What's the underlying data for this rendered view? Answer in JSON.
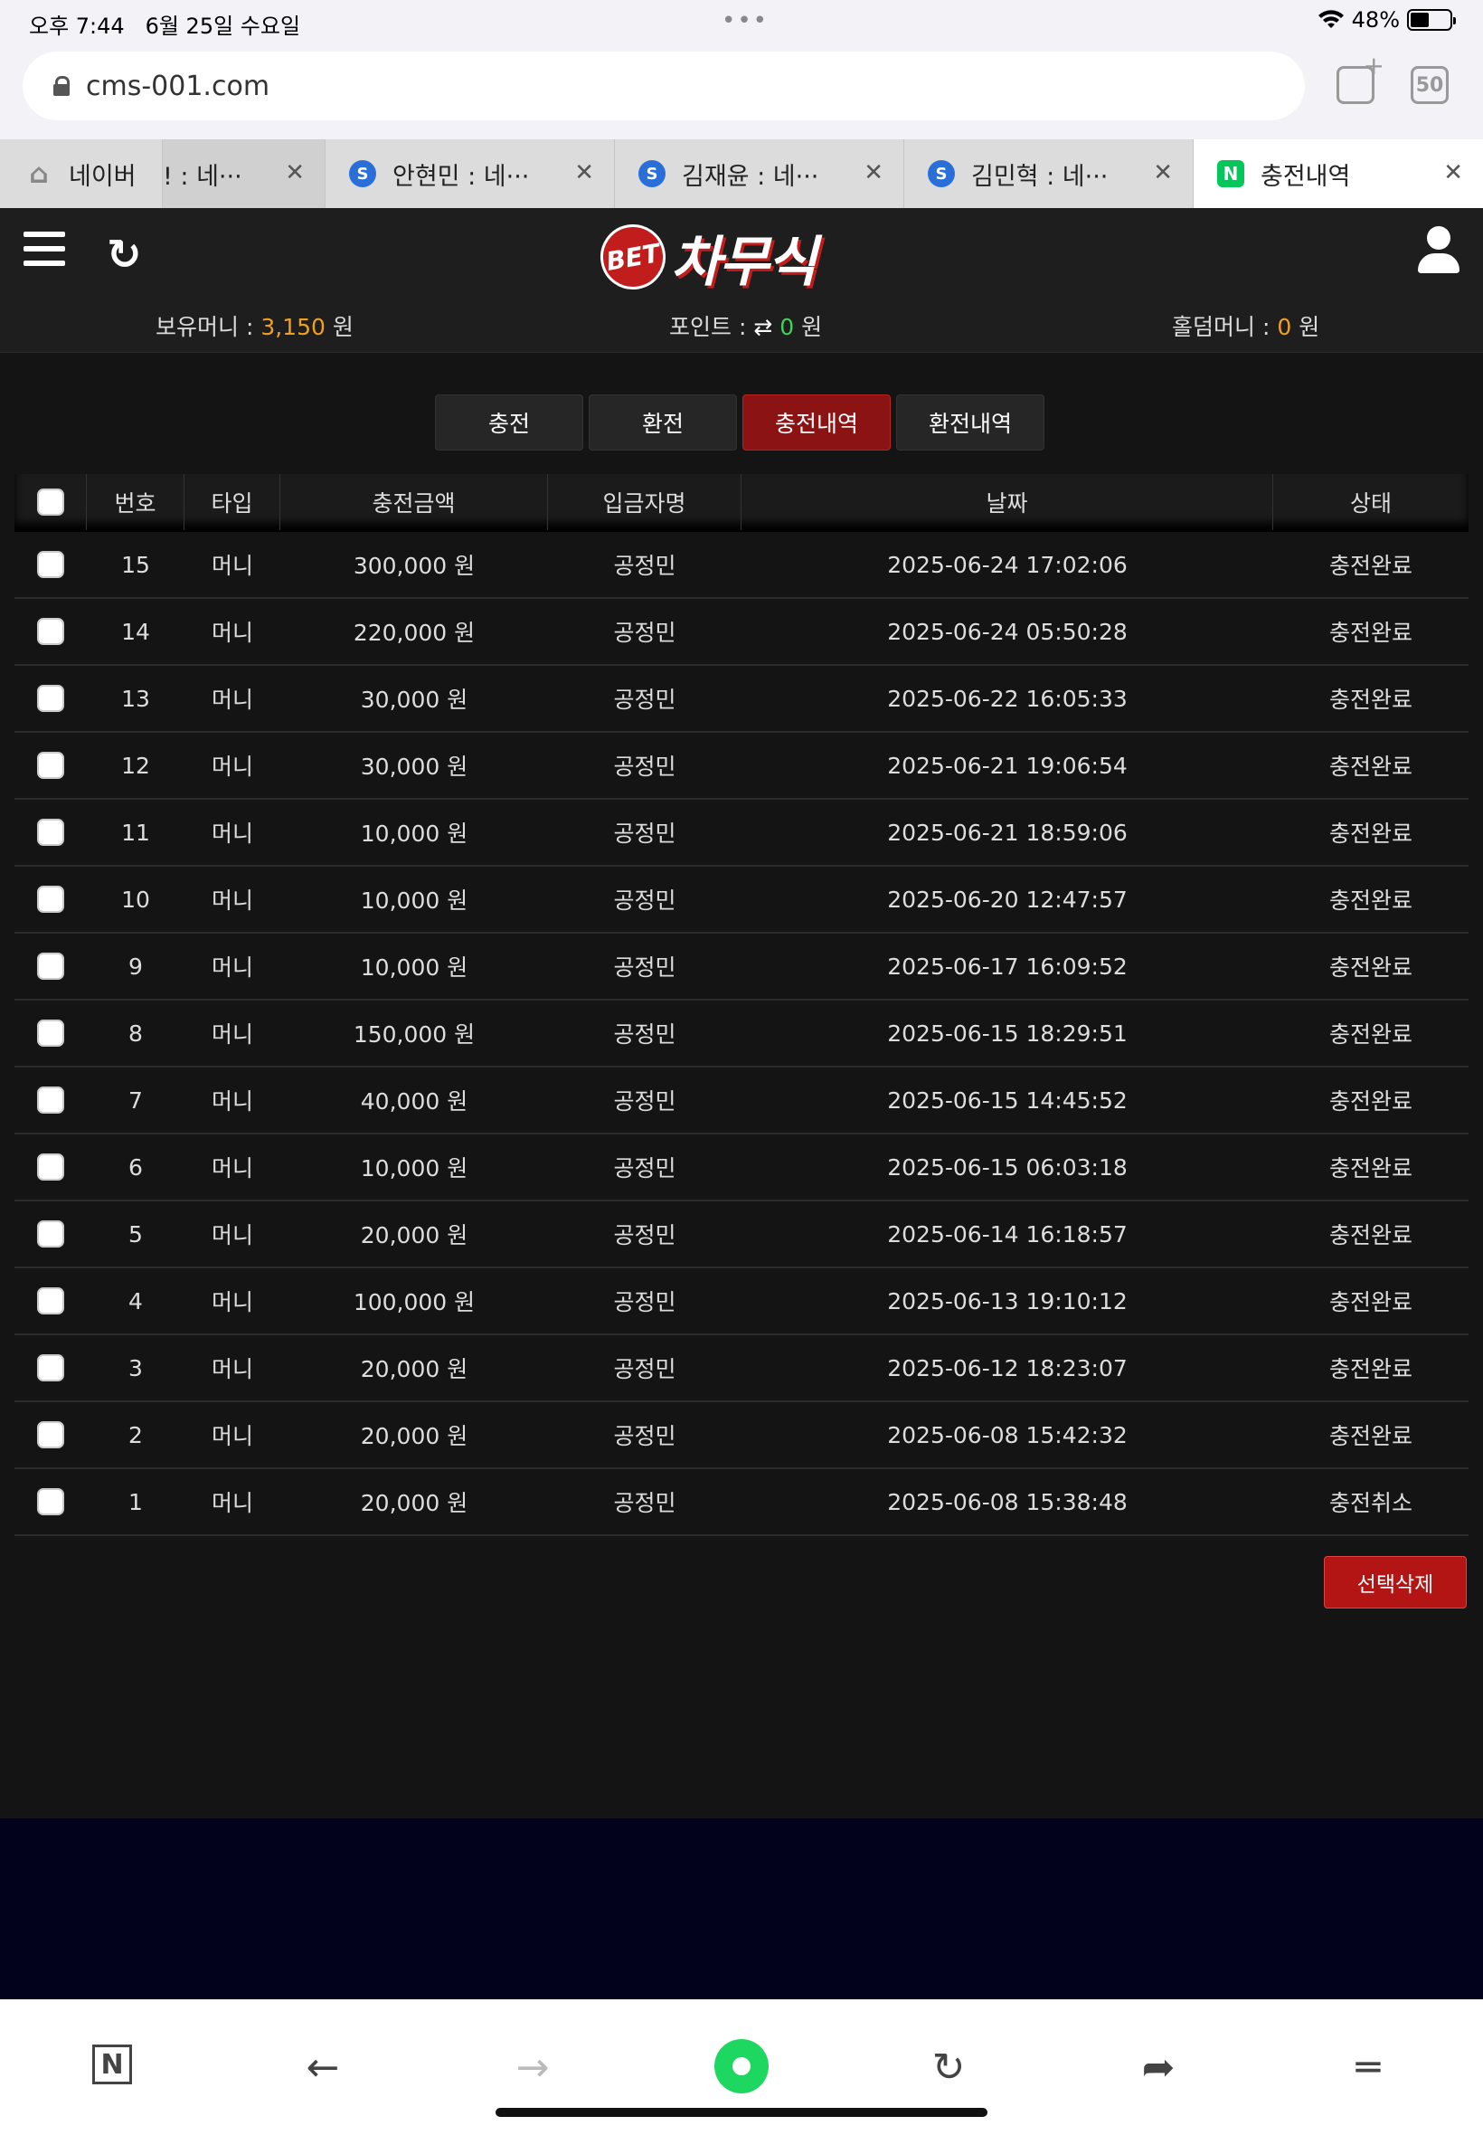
{
  "status": {
    "time": "오후 7:44",
    "date": "6월 25일 수요일",
    "battery": "48%"
  },
  "browser": {
    "url": "cms-001.com",
    "tab_count": "50",
    "tabs": [
      {
        "label": "네이버",
        "icon": "home-icon"
      },
      {
        "label": "! : 네···",
        "icon": ""
      },
      {
        "label": "안현민 : 네···",
        "icon": "S"
      },
      {
        "label": "김재윤 : 네···",
        "icon": "S"
      },
      {
        "label": "김민혁 : 네···",
        "icon": "S"
      },
      {
        "label": "충전내역",
        "icon": "N"
      }
    ]
  },
  "site": {
    "logo_bet": "BET",
    "logo_name": "차무식",
    "balance_label": "보유머니 :",
    "balance_value": "3,150",
    "point_label": "포인트 :",
    "point_icon": "⇄",
    "point_value": "0",
    "hold_label": "홀덤머니 :",
    "hold_value": "0",
    "won": "원"
  },
  "tabs": {
    "charge": "충전",
    "exchange": "환전",
    "charge_history": "충전내역",
    "exchange_history": "환전내역"
  },
  "table": {
    "headers": [
      "번호",
      "타입",
      "충전금액",
      "입금자명",
      "날짜",
      "상태"
    ],
    "rows": [
      {
        "no": "15",
        "type": "머니",
        "amount": "300,000 원",
        "name": "공정민",
        "date": "2025-06-24 17:02:06",
        "status": "충전완료"
      },
      {
        "no": "14",
        "type": "머니",
        "amount": "220,000 원",
        "name": "공정민",
        "date": "2025-06-24 05:50:28",
        "status": "충전완료"
      },
      {
        "no": "13",
        "type": "머니",
        "amount": "30,000 원",
        "name": "공정민",
        "date": "2025-06-22 16:05:33",
        "status": "충전완료"
      },
      {
        "no": "12",
        "type": "머니",
        "amount": "30,000 원",
        "name": "공정민",
        "date": "2025-06-21 19:06:54",
        "status": "충전완료"
      },
      {
        "no": "11",
        "type": "머니",
        "amount": "10,000 원",
        "name": "공정민",
        "date": "2025-06-21 18:59:06",
        "status": "충전완료"
      },
      {
        "no": "10",
        "type": "머니",
        "amount": "10,000 원",
        "name": "공정민",
        "date": "2025-06-20 12:47:57",
        "status": "충전완료"
      },
      {
        "no": "9",
        "type": "머니",
        "amount": "10,000 원",
        "name": "공정민",
        "date": "2025-06-17 16:09:52",
        "status": "충전완료"
      },
      {
        "no": "8",
        "type": "머니",
        "amount": "150,000 원",
        "name": "공정민",
        "date": "2025-06-15 18:29:51",
        "status": "충전완료"
      },
      {
        "no": "7",
        "type": "머니",
        "amount": "40,000 원",
        "name": "공정민",
        "date": "2025-06-15 14:45:52",
        "status": "충전완료"
      },
      {
        "no": "6",
        "type": "머니",
        "amount": "10,000 원",
        "name": "공정민",
        "date": "2025-06-15 06:03:18",
        "status": "충전완료"
      },
      {
        "no": "5",
        "type": "머니",
        "amount": "20,000 원",
        "name": "공정민",
        "date": "2025-06-14 16:18:57",
        "status": "충전완료"
      },
      {
        "no": "4",
        "type": "머니",
        "amount": "100,000 원",
        "name": "공정민",
        "date": "2025-06-13 19:10:12",
        "status": "충전완료"
      },
      {
        "no": "3",
        "type": "머니",
        "amount": "20,000 원",
        "name": "공정민",
        "date": "2025-06-12 18:23:07",
        "status": "충전완료"
      },
      {
        "no": "2",
        "type": "머니",
        "amount": "20,000 원",
        "name": "공정민",
        "date": "2025-06-08 15:42:32",
        "status": "충전완료"
      },
      {
        "no": "1",
        "type": "머니",
        "amount": "20,000 원",
        "name": "공정민",
        "date": "2025-06-08 15:38:48",
        "status": "충전취소"
      }
    ]
  },
  "delete_selected": "선택삭제",
  "colors": {
    "accent_red": "#8b1313",
    "balance_orange": "#f0a020",
    "point_green": "#3fd25a"
  }
}
